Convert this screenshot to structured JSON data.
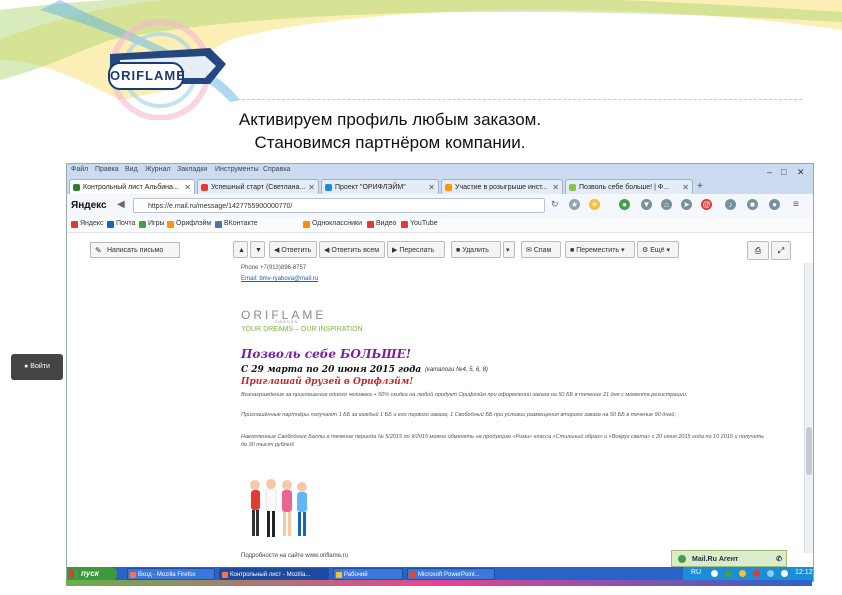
{
  "slide": {
    "logo_text": "ORIFLAME",
    "caption_line1": "Активируем профиль любым заказом.",
    "caption_line2": "Становимся партнёром компании."
  },
  "browser": {
    "menu": [
      "Файл",
      "Правка",
      "Вид",
      "Журнал",
      "Закладки",
      "Инструменты",
      "Справка"
    ],
    "tabs": [
      {
        "label": "Контрольный лист Альбина...",
        "icon_color": "#2e7d32",
        "active": true
      },
      {
        "label": "Успешный старт (Светлана...",
        "icon_color": "#e53935",
        "active": false
      },
      {
        "label": "Проект \"ОРИФЛЭЙМ\"",
        "icon_color": "#1e88e5",
        "active": false
      },
      {
        "label": "Участие в розыгрыше инст...",
        "icon_color": "#ff9800",
        "active": false
      },
      {
        "label": "Позволь себе больше! | Ф...",
        "icon_color": "#8bc34a",
        "active": false
      }
    ],
    "search_engine": "Яндекс",
    "url": "https://e.mail.ru/message/1427755900000770/",
    "bookmarks": [
      {
        "label": "Яндекс",
        "icon_color": "#e53935"
      },
      {
        "label": "Почта",
        "icon_color": "#1565c0"
      },
      {
        "label": "Игры",
        "icon_color": "#43a047"
      },
      {
        "label": "Орифлэйм",
        "icon_color": "#ff9800"
      },
      {
        "label": "ВКонтакте",
        "icon_color": "#4a76a8"
      },
      {
        "label": "Одноклассники",
        "icon_color": "#ff8f00"
      },
      {
        "label": "Видео",
        "icon_color": "#e53935"
      },
      {
        "label": "YouTube",
        "icon_color": "#e53935"
      }
    ]
  },
  "mail": {
    "compose_label": "Написать письмо",
    "toolbar": [
      "Ответить",
      "Ответить всем",
      "Переслать",
      "Удалить",
      "Спам",
      "Переместить",
      "Ещё"
    ],
    "phone_line": "Phone +7(913)896-8757",
    "email_line": "Email: bmv-ryabova@mail.ru",
    "logo": "ORIFLAME",
    "logo_sub": "SWEDEN",
    "slogan": "YOUR DREAMS – OUR INSPIRATION",
    "promo_title": "Позволь себе БОЛЬШЕ!",
    "promo_dates": "С 29 марта по 20 июня 2015 года",
    "promo_dates_note": "(каталоги №4, 5, 6, 8)",
    "promo_invite": "Приглашай друзей в Орифлэйм!",
    "terms": [
      "Вознаграждение за приглашение одного человека + 50% скидка на любой продукт Орифлэйм при оформлении заказа на 50 ББ в течение 21 дня с момента регистрации.",
      "Приглашённые партнёры получают 1 ББ за каждый 1 ББ и его первого заказа; 1 Свободный ББ при условии размещения второго заказа на 50 ББ в течение 90 дней;",
      "Накопленные Свободные Баллы в течение периода № 5/2015 по 9/2015 можно обменять на продукцию «Рими» класса «Стильный образ» и «Вокруг света» с 20 июня 2015 года по 10 2015 и получить до 30 тысяч рублей!"
    ],
    "site_line": "Подробности на сайте www.oriflame.ru"
  },
  "enter_button": "Войти",
  "agent_label": "Mail.Ru Агент",
  "taskbar": {
    "start_label": "пуск",
    "buttons": [
      "Вход - Mozilla Firefox",
      "Контрольный лист - Mozilla...",
      "Рабочий",
      "Microsoft PowerPoint..."
    ],
    "lang": "RU",
    "clock": "12:12"
  }
}
